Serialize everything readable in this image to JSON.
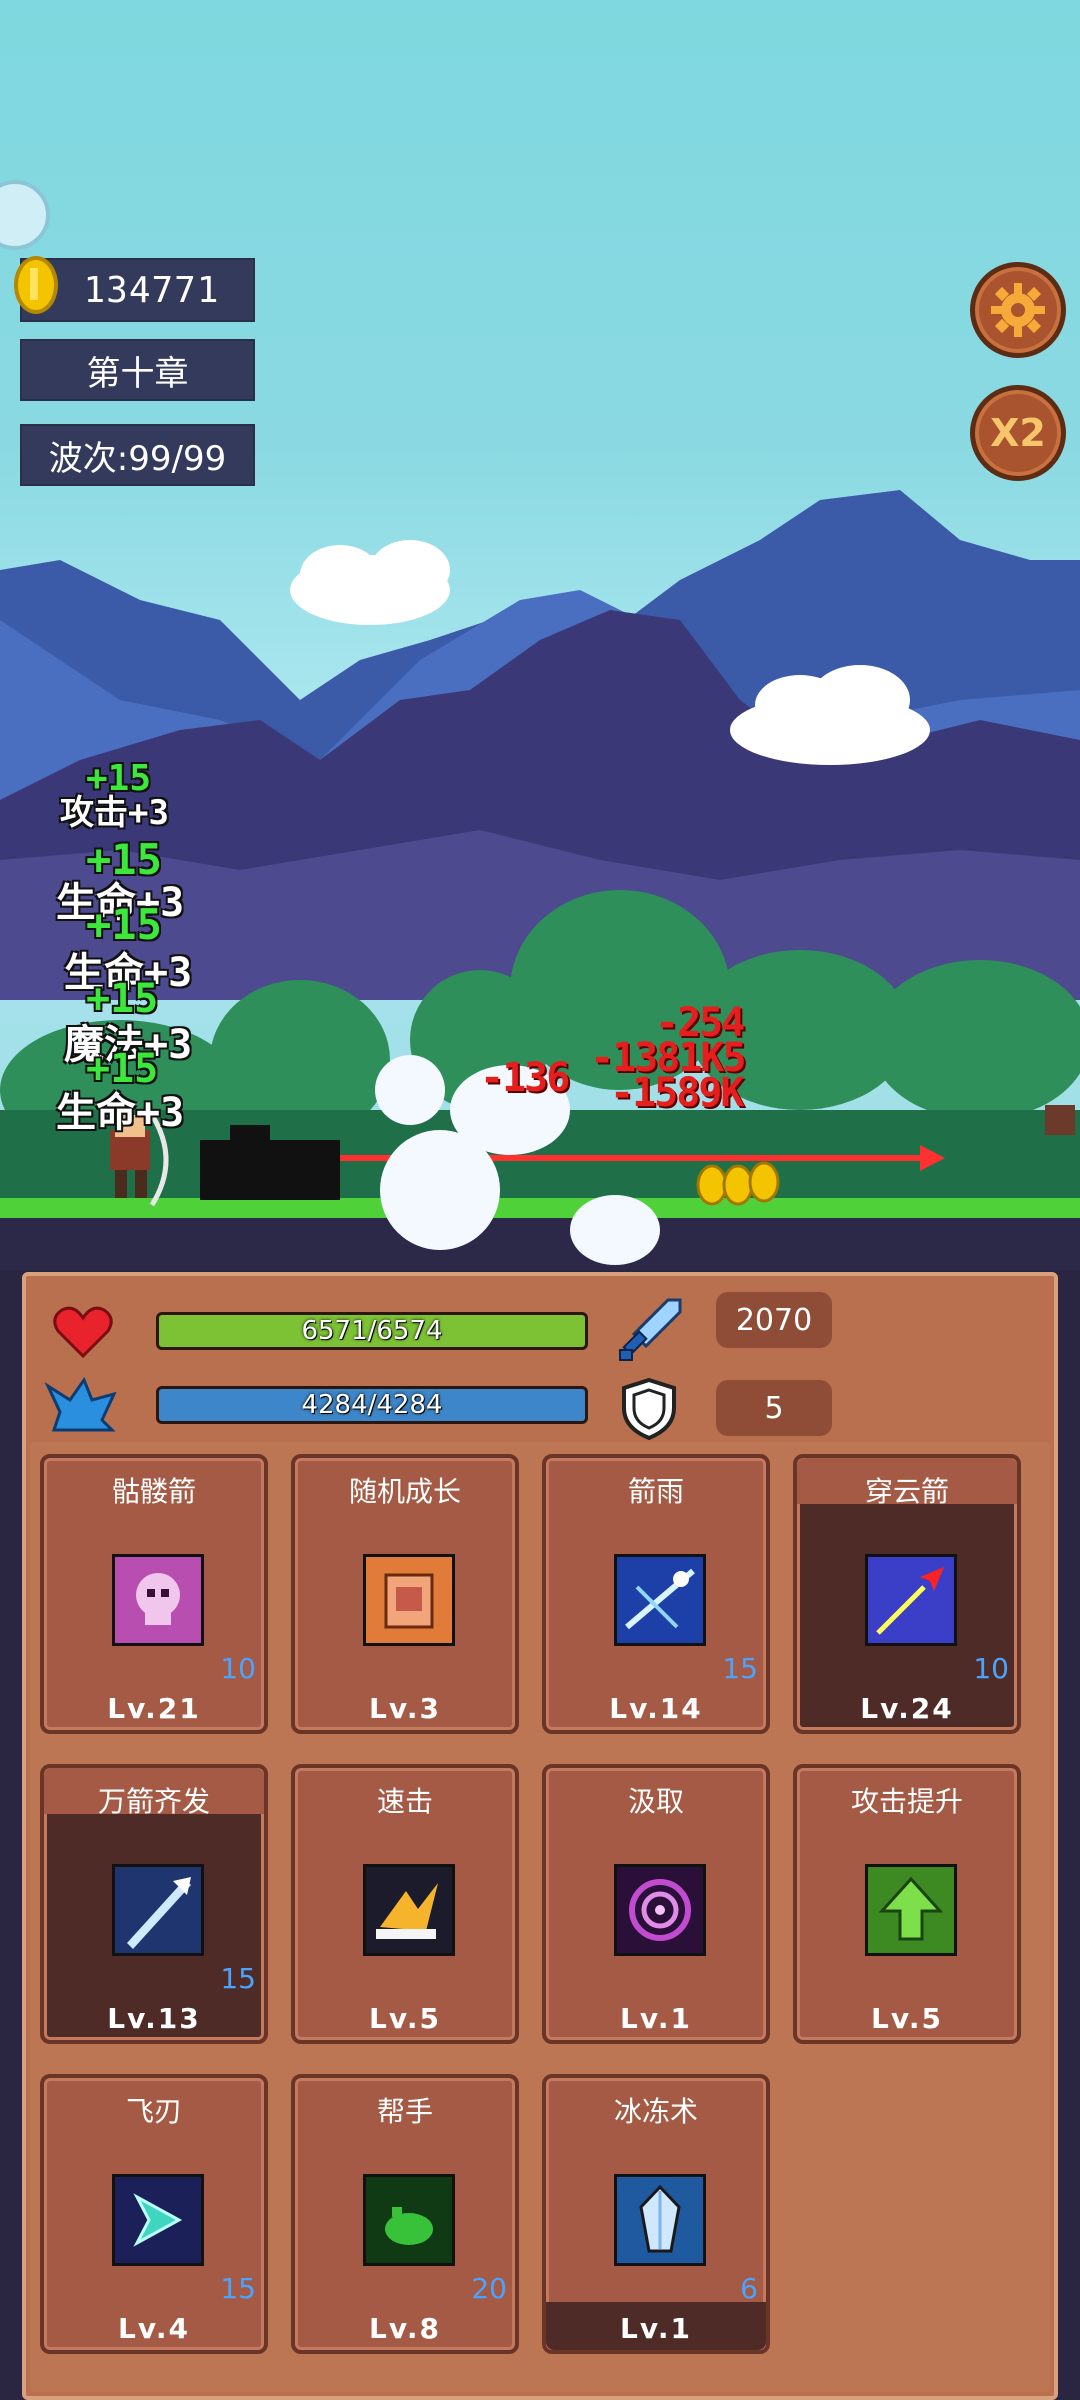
{
  "hud": {
    "coins": "134771",
    "chapter": "第十章",
    "wave": "波次:99/99",
    "speed_label": "X2"
  },
  "floating_texts": [
    {
      "text": "+15",
      "color": "#3ce83c"
    },
    {
      "text": "攻击+3",
      "color": "#ffffff"
    },
    {
      "text": "+15",
      "color": "#3ce83c"
    },
    {
      "text": "生命+3",
      "color": "#ffffff"
    },
    {
      "text": "+15",
      "color": "#3ce83c"
    },
    {
      "text": "生命+3",
      "color": "#ffffff"
    },
    {
      "text": "+15",
      "color": "#3ce83c"
    },
    {
      "text": "魔法+3",
      "color": "#ffffff"
    },
    {
      "text": "+15",
      "color": "#3ce83c"
    },
    {
      "text": "生命+3",
      "color": "#ffffff"
    }
  ],
  "damage_texts": [
    "-254",
    "-136",
    "-1381K5",
    "-1589K"
  ],
  "stats": {
    "hp_label": "6571/6574",
    "hp_fraction": 0.9995,
    "mp_label": "4284/4284",
    "mp_fraction": 1.0,
    "attack": "2070",
    "defense": "5",
    "colors": {
      "hp": "#7cc234",
      "mp": "#3d86c9"
    }
  },
  "skills": [
    {
      "name": "骷髅箭",
      "count": "10",
      "level": "Lv.21",
      "icon": "skull-icon",
      "style": "normal"
    },
    {
      "name": "随机成长",
      "count": "",
      "level": "Lv.3",
      "icon": "fist-icon",
      "style": "normal"
    },
    {
      "name": "箭雨",
      "count": "15",
      "level": "Lv.14",
      "icon": "arrow-rain-icon",
      "style": "normal"
    },
    {
      "name": "穿云箭",
      "count": "10",
      "level": "Lv.24",
      "icon": "piercing-arrow-icon",
      "style": "dark"
    },
    {
      "name": "万箭齐发",
      "count": "15",
      "level": "Lv.13",
      "icon": "volley-icon",
      "style": "dark"
    },
    {
      "name": "速击",
      "count": "",
      "level": "Lv.5",
      "icon": "quick-strike-icon",
      "style": "normal"
    },
    {
      "name": "汲取",
      "count": "",
      "level": "Lv.1",
      "icon": "vortex-icon",
      "style": "normal"
    },
    {
      "name": "攻击提升",
      "count": "",
      "level": "Lv.5",
      "icon": "up-arrow-icon",
      "style": "normal"
    },
    {
      "name": "飞刃",
      "count": "15",
      "level": "Lv.4",
      "icon": "flying-blade-icon",
      "style": "normal"
    },
    {
      "name": "帮手",
      "count": "20",
      "level": "Lv.8",
      "icon": "slime-icon",
      "style": "normal"
    },
    {
      "name": "冰冻术",
      "count": "6",
      "level": "Lv.1",
      "icon": "ice-crystal-icon",
      "style": "dark-bottom"
    }
  ]
}
